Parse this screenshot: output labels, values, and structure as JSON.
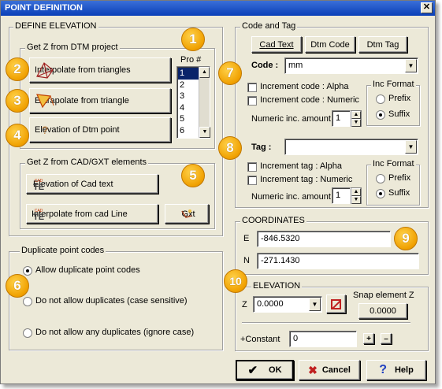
{
  "window": {
    "title": "POINT DEFINITION",
    "close": "✕"
  },
  "define_elevation": {
    "legend": "DEFINE ELEVATION",
    "dtm_group": {
      "legend": "Get Z from DTM project",
      "interpolate_triangles": "Interpolate from triangles",
      "extrapolate_triangle": "Extrapolate from triangle",
      "elevation_dtm_point": "Elevation of Dtm point",
      "pro_header": "Pro #",
      "pro_items": [
        "1",
        "2",
        "3",
        "4",
        "5",
        "6"
      ]
    },
    "cad_group": {
      "legend": "Get Z from CAD/GXT elements",
      "elevation_cad_text": "Elevation of Cad text",
      "interpolate_cad_line": "Interpolate from cad Line",
      "gxt": "Gxt",
      "cad_icon_top": "CAD",
      "cad_icon_main": "TE"
    }
  },
  "duplicate_codes": {
    "legend": "Duplicate point codes",
    "allow": "Allow duplicate point codes",
    "no_dup_sensitive": "Do not allow duplicates (case sensitive)",
    "no_dup_ignore": "Do not allow any duplicates (ignore case)",
    "selected": "allow"
  },
  "code_tag": {
    "legend": "Code and Tag",
    "cad_text_btn": "Cad Text",
    "dtm_code_btn": "Dtm Code",
    "dtm_tag_btn": "Dtm Tag",
    "code_label": "Code :",
    "code_value": "mm",
    "inc_code_alpha": "Increment code : Alpha",
    "inc_code_numeric": "Increment code : Numeric",
    "numeric_inc_amount": "Numeric inc. amount",
    "code_inc_value": "1",
    "inc_format": "Inc Format",
    "prefix": "Prefix",
    "suffix": "Suffix",
    "tag_label": "Tag :",
    "tag_value": "",
    "inc_tag_alpha": "Increment tag : Alpha",
    "inc_tag_numeric": "Increment tag : Numeric",
    "tag_inc_value": "1"
  },
  "coordinates": {
    "legend": "COORDINATES",
    "e_label": "E",
    "e_value": "-846.5320",
    "n_label": "N",
    "n_value": "-271.1430"
  },
  "elevation": {
    "legend": "ELEVATION",
    "z_label": "Z",
    "z_value": "0.0000",
    "snap_label": "Snap element Z",
    "snap_value": "0.0000",
    "constant_label": "+Constant",
    "constant_value": "0",
    "plus": "+",
    "minus": "–"
  },
  "footer": {
    "ok": "OK",
    "cancel": "Cancel",
    "help": "Help"
  },
  "badges": [
    "1",
    "2",
    "3",
    "4",
    "5",
    "6",
    "7",
    "8",
    "9",
    "10"
  ],
  "colors": {
    "badge": "#f0a000",
    "titlebar": "#0a3fb8",
    "dialog_bg": "#ece9d8"
  }
}
